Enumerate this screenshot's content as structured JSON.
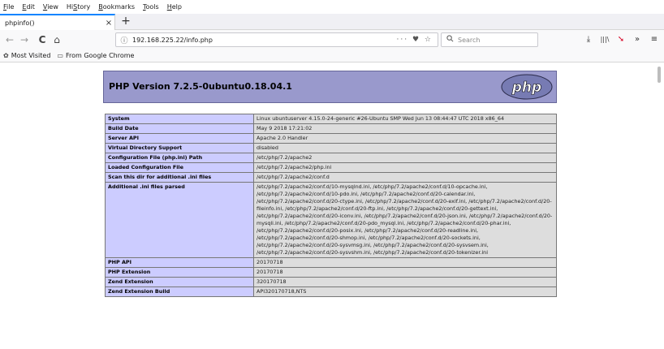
{
  "menu": {
    "items": [
      {
        "key": "F",
        "rest": "ile"
      },
      {
        "key": "E",
        "rest": "dit"
      },
      {
        "key": "V",
        "rest": "iew"
      },
      {
        "key": "S",
        "rest": "History",
        "pre": "Hi",
        "post": "tory"
      },
      {
        "key": "B",
        "rest": "ookmarks"
      },
      {
        "key": "T",
        "rest": "ools"
      },
      {
        "key": "H",
        "rest": "elp"
      }
    ]
  },
  "tab": {
    "title": "phpinfo()",
    "close": "×"
  },
  "newtab": "+",
  "nav": {
    "back": "←",
    "forward": "→",
    "reload": "C",
    "home": "⌂"
  },
  "url": {
    "info_icon": "ⓘ",
    "text": "192.168.225.22/info.php",
    "actions": "··· ♥ ☆"
  },
  "search": {
    "icon": "🔍",
    "placeholder": "Search"
  },
  "toolbar": {
    "download": "⤓",
    "library": "|||\\",
    "ext": "➘",
    "overflow": "»",
    "menu": "≡"
  },
  "bookmarks": {
    "items": [
      {
        "icon": "✿",
        "label": "Most Visited"
      },
      {
        "icon": "▭",
        "label": "From Google Chrome"
      }
    ]
  },
  "php": {
    "version": "PHP Version 7.2.5-0ubuntu0.18.04.1",
    "logo": "php",
    "rows": [
      {
        "key": "System",
        "value": "Linux ubuntuserver 4.15.0-24-generic #26-Ubuntu SMP Wed Jun 13 08:44:47 UTC 2018 x86_64"
      },
      {
        "key": "Build Date",
        "value": "May 9 2018 17:21:02"
      },
      {
        "key": "Server API",
        "value": "Apache 2.0 Handler"
      },
      {
        "key": "Virtual Directory Support",
        "value": "disabled"
      },
      {
        "key": "Configuration File (php.ini) Path",
        "value": "/etc/php/7.2/apache2"
      },
      {
        "key": "Loaded Configuration File",
        "value": "/etc/php/7.2/apache2/php.ini"
      },
      {
        "key": "Scan this dir for additional .ini files",
        "value": "/etc/php/7.2/apache2/conf.d"
      },
      {
        "key": "Additional .ini files parsed",
        "value": "/etc/php/7.2/apache2/conf.d/10-mysqlnd.ini, /etc/php/7.2/apache2/conf.d/10-opcache.ini, /etc/php/7.2/apache2/conf.d/10-pdo.ini, /etc/php/7.2/apache2/conf.d/20-calendar.ini, /etc/php/7.2/apache2/conf.d/20-ctype.ini, /etc/php/7.2/apache2/conf.d/20-exif.ini, /etc/php/7.2/apache2/conf.d/20-fileinfo.ini, /etc/php/7.2/apache2/conf.d/20-ftp.ini, /etc/php/7.2/apache2/conf.d/20-gettext.ini, /etc/php/7.2/apache2/conf.d/20-iconv.ini, /etc/php/7.2/apache2/conf.d/20-json.ini, /etc/php/7.2/apache2/conf.d/20-mysqli.ini, /etc/php/7.2/apache2/conf.d/20-pdo_mysql.ini, /etc/php/7.2/apache2/conf.d/20-phar.ini, /etc/php/7.2/apache2/conf.d/20-posix.ini, /etc/php/7.2/apache2/conf.d/20-readline.ini, /etc/php/7.2/apache2/conf.d/20-shmop.ini, /etc/php/7.2/apache2/conf.d/20-sockets.ini, /etc/php/7.2/apache2/conf.d/20-sysvmsg.ini, /etc/php/7.2/apache2/conf.d/20-sysvsem.ini, /etc/php/7.2/apache2/conf.d/20-sysvshm.ini, /etc/php/7.2/apache2/conf.d/20-tokenizer.ini"
      },
      {
        "key": "PHP API",
        "value": "20170718"
      },
      {
        "key": "PHP Extension",
        "value": "20170718"
      },
      {
        "key": "Zend Extension",
        "value": "320170718"
      },
      {
        "key": "Zend Extension Build",
        "value": "API320170718,NTS"
      }
    ]
  }
}
